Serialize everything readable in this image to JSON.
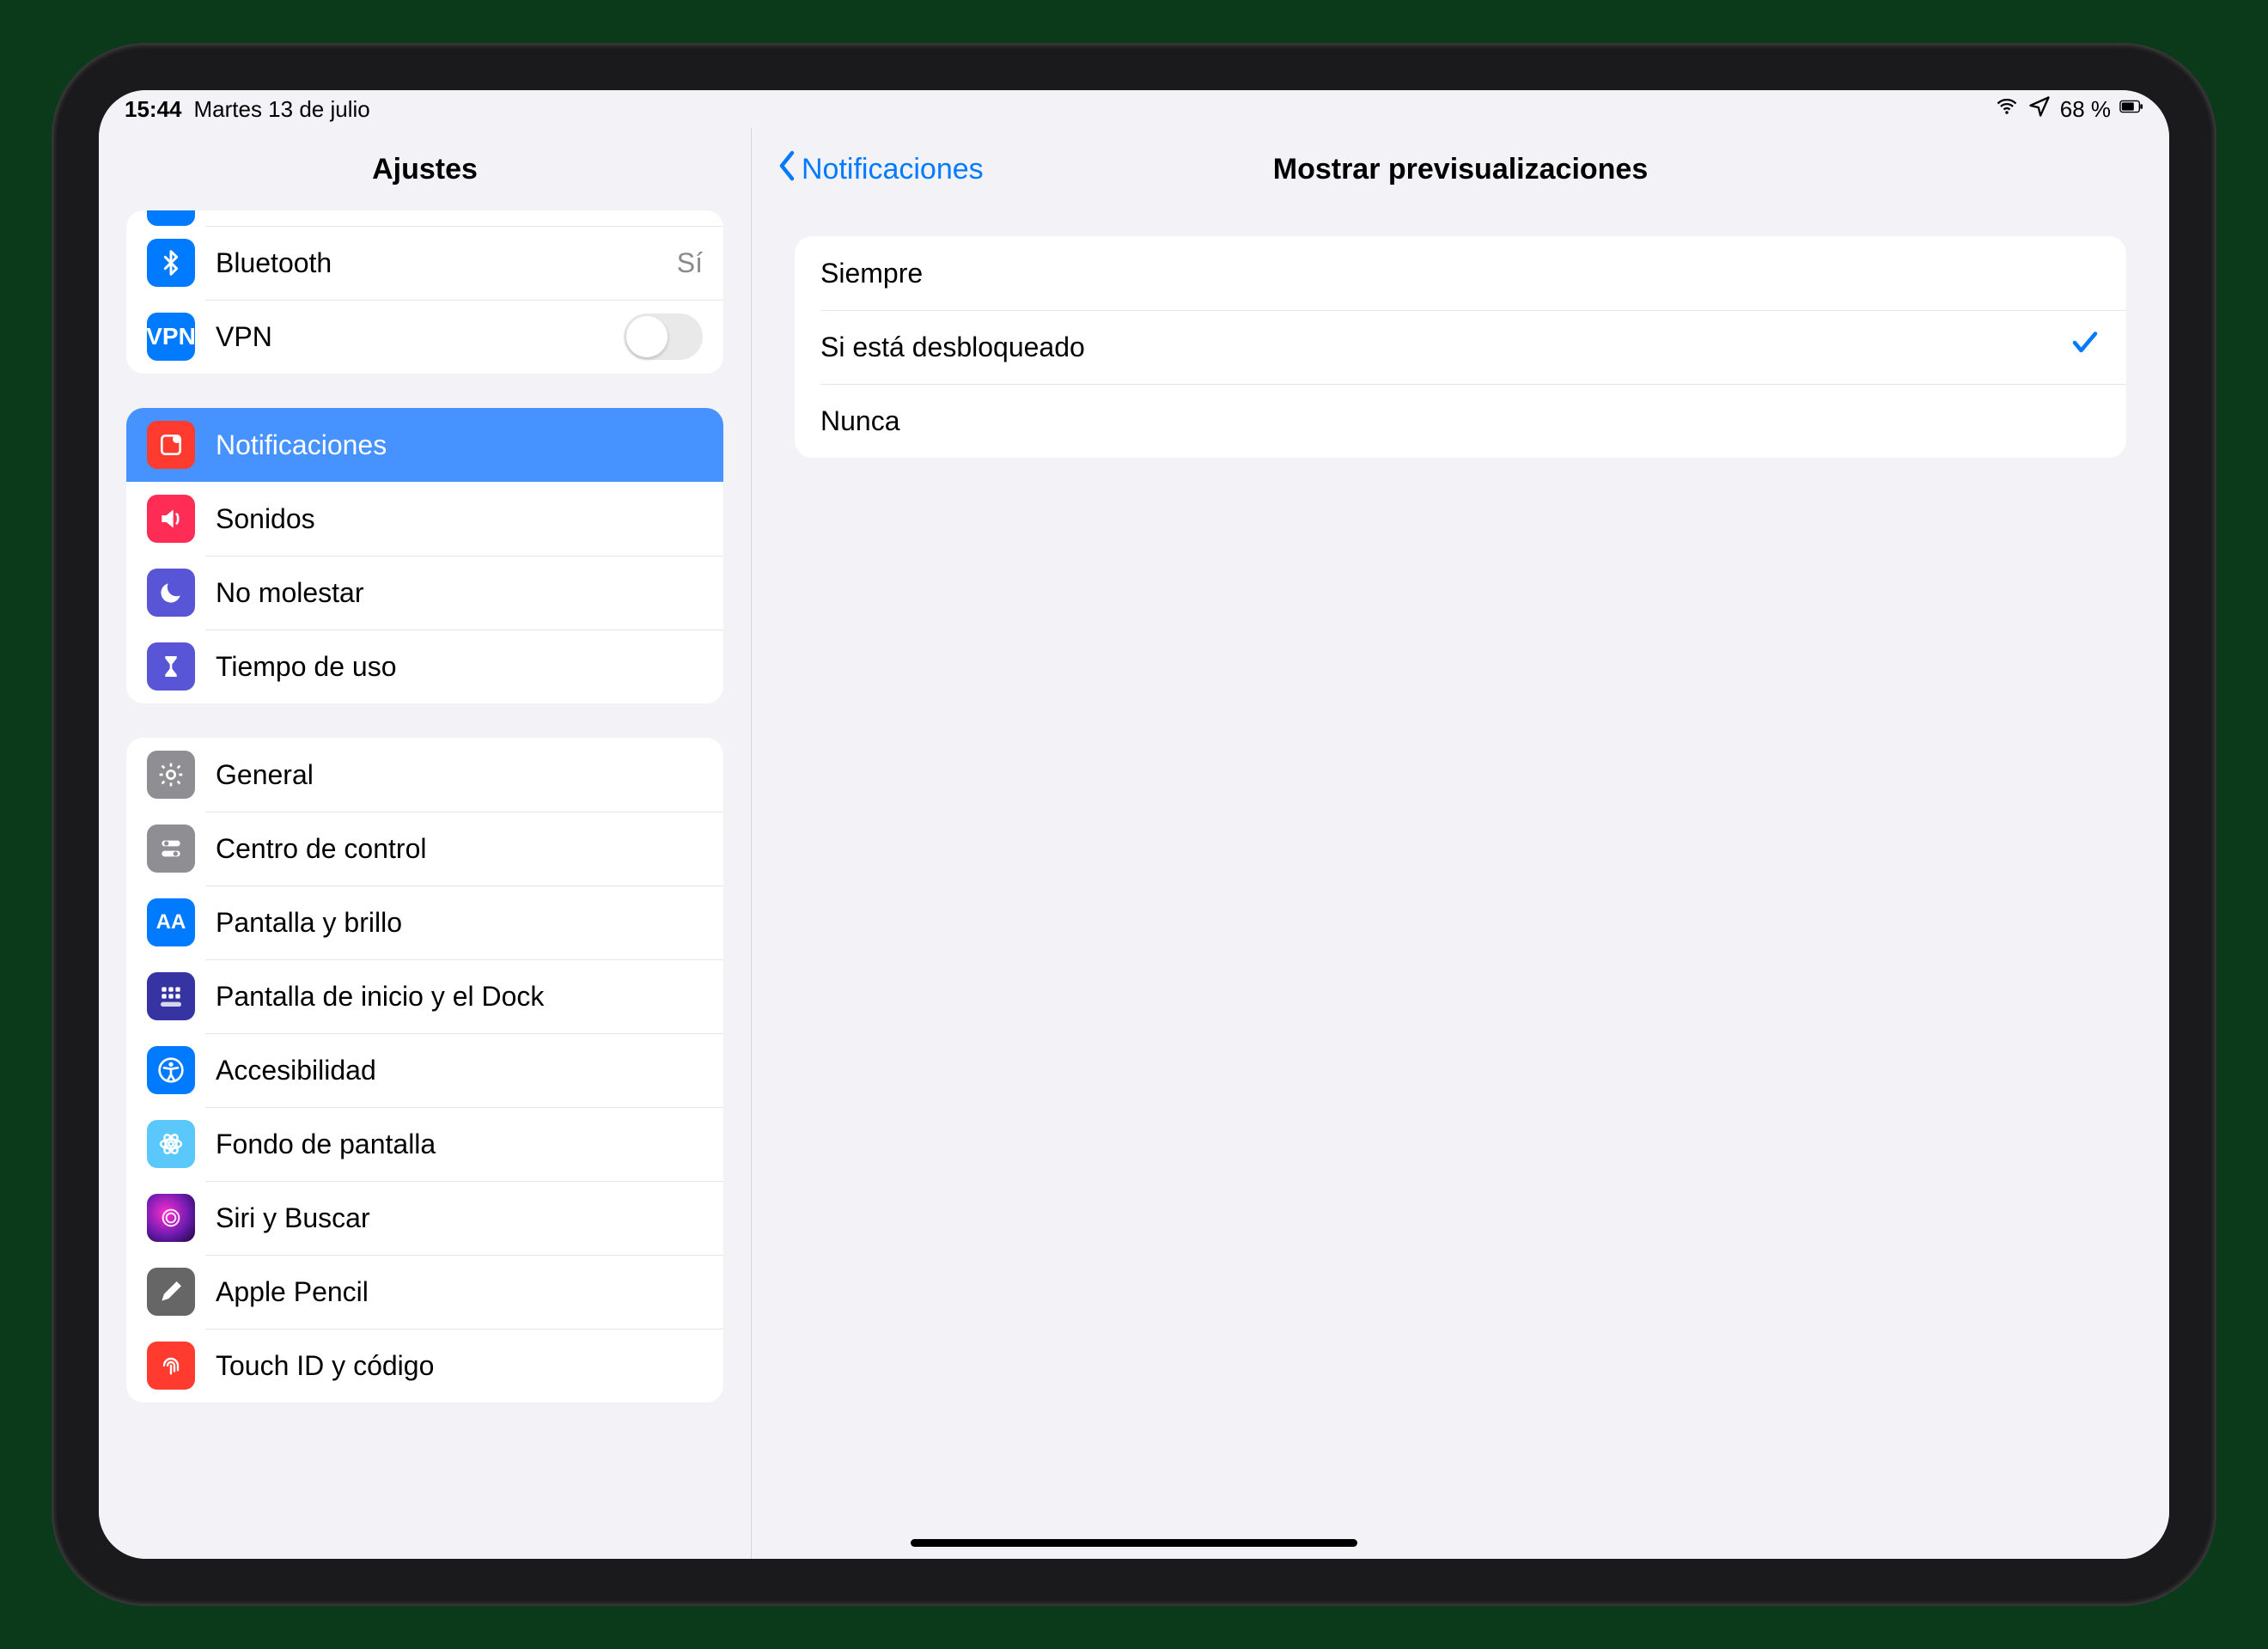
{
  "status": {
    "time": "15:44",
    "date": "Martes 13 de julio",
    "battery_text": "68 %"
  },
  "sidebar": {
    "title": "Ajustes",
    "group0": {
      "bluetooth_label": "Bluetooth",
      "bluetooth_value": "Sí",
      "vpn_label": "VPN",
      "vpn_icon_text": "VPN"
    },
    "group1": {
      "notifications_label": "Notificaciones",
      "sounds_label": "Sonidos",
      "dnd_label": "No molestar",
      "screen_time_label": "Tiempo de uso"
    },
    "group2": {
      "general_label": "General",
      "control_center_label": "Centro de control",
      "display_label": "Pantalla y brillo",
      "display_icon_text": "AA",
      "home_dock_label": "Pantalla de inicio y el Dock",
      "accessibility_label": "Accesibilidad",
      "wallpaper_label": "Fondo de pantalla",
      "siri_label": "Siri y Buscar",
      "pencil_label": "Apple Pencil",
      "touch_id_label": "Touch ID y código"
    }
  },
  "detail": {
    "back_label": "Notificaciones",
    "title": "Mostrar previsualizaciones",
    "options": {
      "always": "Siempre",
      "when_unlocked": "Si está desbloqueado",
      "never": "Nunca"
    },
    "selected": "when_unlocked"
  }
}
